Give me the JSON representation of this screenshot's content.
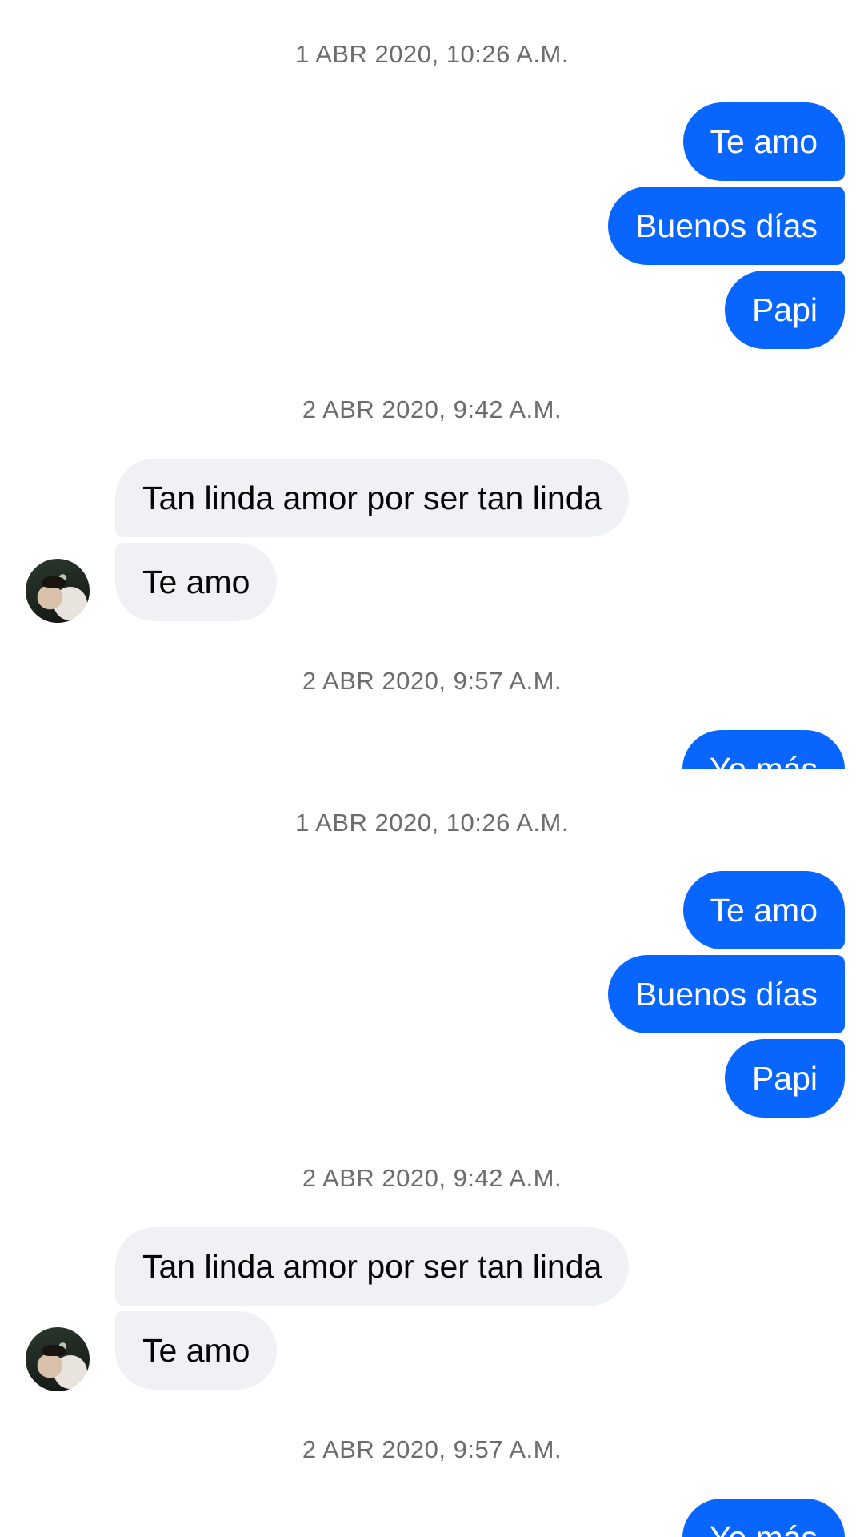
{
  "panels": [
    {
      "timestamps": [
        "1 ABR 2020, 10:26 A.M.",
        "2 ABR 2020, 9:42 A.M.",
        "2 ABR 2020, 9:57 A.M."
      ],
      "outgoing_group1": [
        "Te amo",
        "Buenos días",
        "Papi"
      ],
      "incoming_group": [
        "Tan linda amor por ser tan linda",
        "Te amo"
      ],
      "outgoing_partial": "Yo más"
    },
    {
      "timestamps": [
        "1 ABR 2020, 10:26 A.M.",
        "2 ABR 2020, 9:42 A.M.",
        "2 ABR 2020, 9:57 A.M."
      ],
      "outgoing_group1": [
        "Te amo",
        "Buenos días",
        "Papi"
      ],
      "incoming_group": [
        "Tan linda amor por ser tan linda",
        "Te amo"
      ],
      "outgoing_partial": "Yo más"
    }
  ],
  "colors": {
    "outgoing_bubble": "#0866ff",
    "incoming_bubble": "#f0f1f4",
    "timestamp_text": "#6b6b70"
  }
}
